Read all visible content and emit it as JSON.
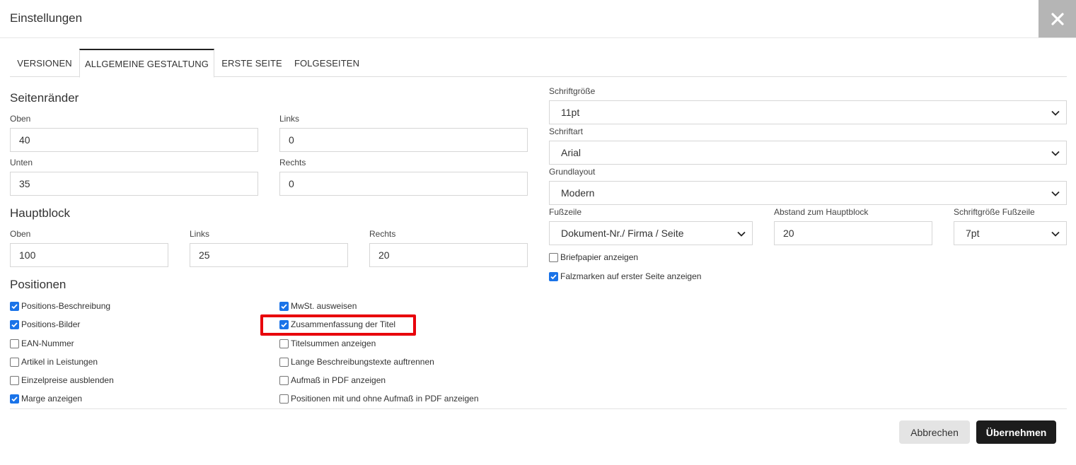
{
  "dialog": {
    "title": "Einstellungen"
  },
  "tabs": [
    {
      "label": "VERSIONEN",
      "active": false
    },
    {
      "label": "ALLGEMEINE GESTALTUNG",
      "active": true
    },
    {
      "label": "ERSTE SEITE",
      "active": false
    },
    {
      "label": "FOLGESEITEN",
      "active": false
    }
  ],
  "seitenraender": {
    "title": "Seitenränder",
    "oben": {
      "label": "Oben",
      "value": "40"
    },
    "links": {
      "label": "Links",
      "value": "0"
    },
    "unten": {
      "label": "Unten",
      "value": "35"
    },
    "rechts": {
      "label": "Rechts",
      "value": "0"
    }
  },
  "hauptblock": {
    "title": "Hauptblock",
    "oben": {
      "label": "Oben",
      "value": "100"
    },
    "links": {
      "label": "Links",
      "value": "25"
    },
    "rechts": {
      "label": "Rechts",
      "value": "20"
    }
  },
  "positionen": {
    "title": "Positionen",
    "left": [
      {
        "label": "Positions-Beschreibung",
        "checked": true
      },
      {
        "label": "Positions-Bilder",
        "checked": true
      },
      {
        "label": "EAN-Nummer",
        "checked": false
      },
      {
        "label": "Artikel in Leistungen",
        "checked": false
      },
      {
        "label": "Einzelpreise ausblenden",
        "checked": false
      },
      {
        "label": "Marge anzeigen",
        "checked": true
      }
    ],
    "right": [
      {
        "label": "MwSt. ausweisen",
        "checked": true
      },
      {
        "label": "Zusammenfassung der Titel",
        "checked": true
      },
      {
        "label": "Titelsummen anzeigen",
        "checked": false
      },
      {
        "label": "Lange Beschreibungstexte auftrennen",
        "checked": false
      },
      {
        "label": "Aufmaß in PDF anzeigen",
        "checked": false
      },
      {
        "label": "Positionen mit und ohne Aufmaß in PDF anzeigen",
        "checked": false
      }
    ]
  },
  "typo": {
    "schriftgroesse": {
      "label": "Schriftgröße",
      "value": "11pt"
    },
    "schriftart": {
      "label": "Schriftart",
      "value": "Arial"
    },
    "grundlayout": {
      "label": "Grundlayout",
      "value": "Modern"
    },
    "fusszeile": {
      "label": "Fußzeile",
      "value": "Dokument-Nr./ Firma / Seite"
    },
    "abstand": {
      "label": "Abstand zum Hauptblock",
      "value": "20"
    },
    "fusszeile_groesse": {
      "label": "Schriftgröße Fußzeile",
      "value": "7pt"
    },
    "briefpapier": {
      "label": "Briefpapier anzeigen",
      "checked": false
    },
    "falzmarken": {
      "label": "Falzmarken auf erster Seite anzeigen",
      "checked": true
    }
  },
  "footer": {
    "cancel_label": "Abbrechen",
    "apply_label": "Übernehmen"
  },
  "icons": {
    "close": "close-icon",
    "chevron": "chevron-down-icon",
    "check": "check-icon"
  },
  "colors": {
    "accent": "#1a73e8",
    "highlight": "#e8000b",
    "primary_button": "#1c1c1c"
  }
}
